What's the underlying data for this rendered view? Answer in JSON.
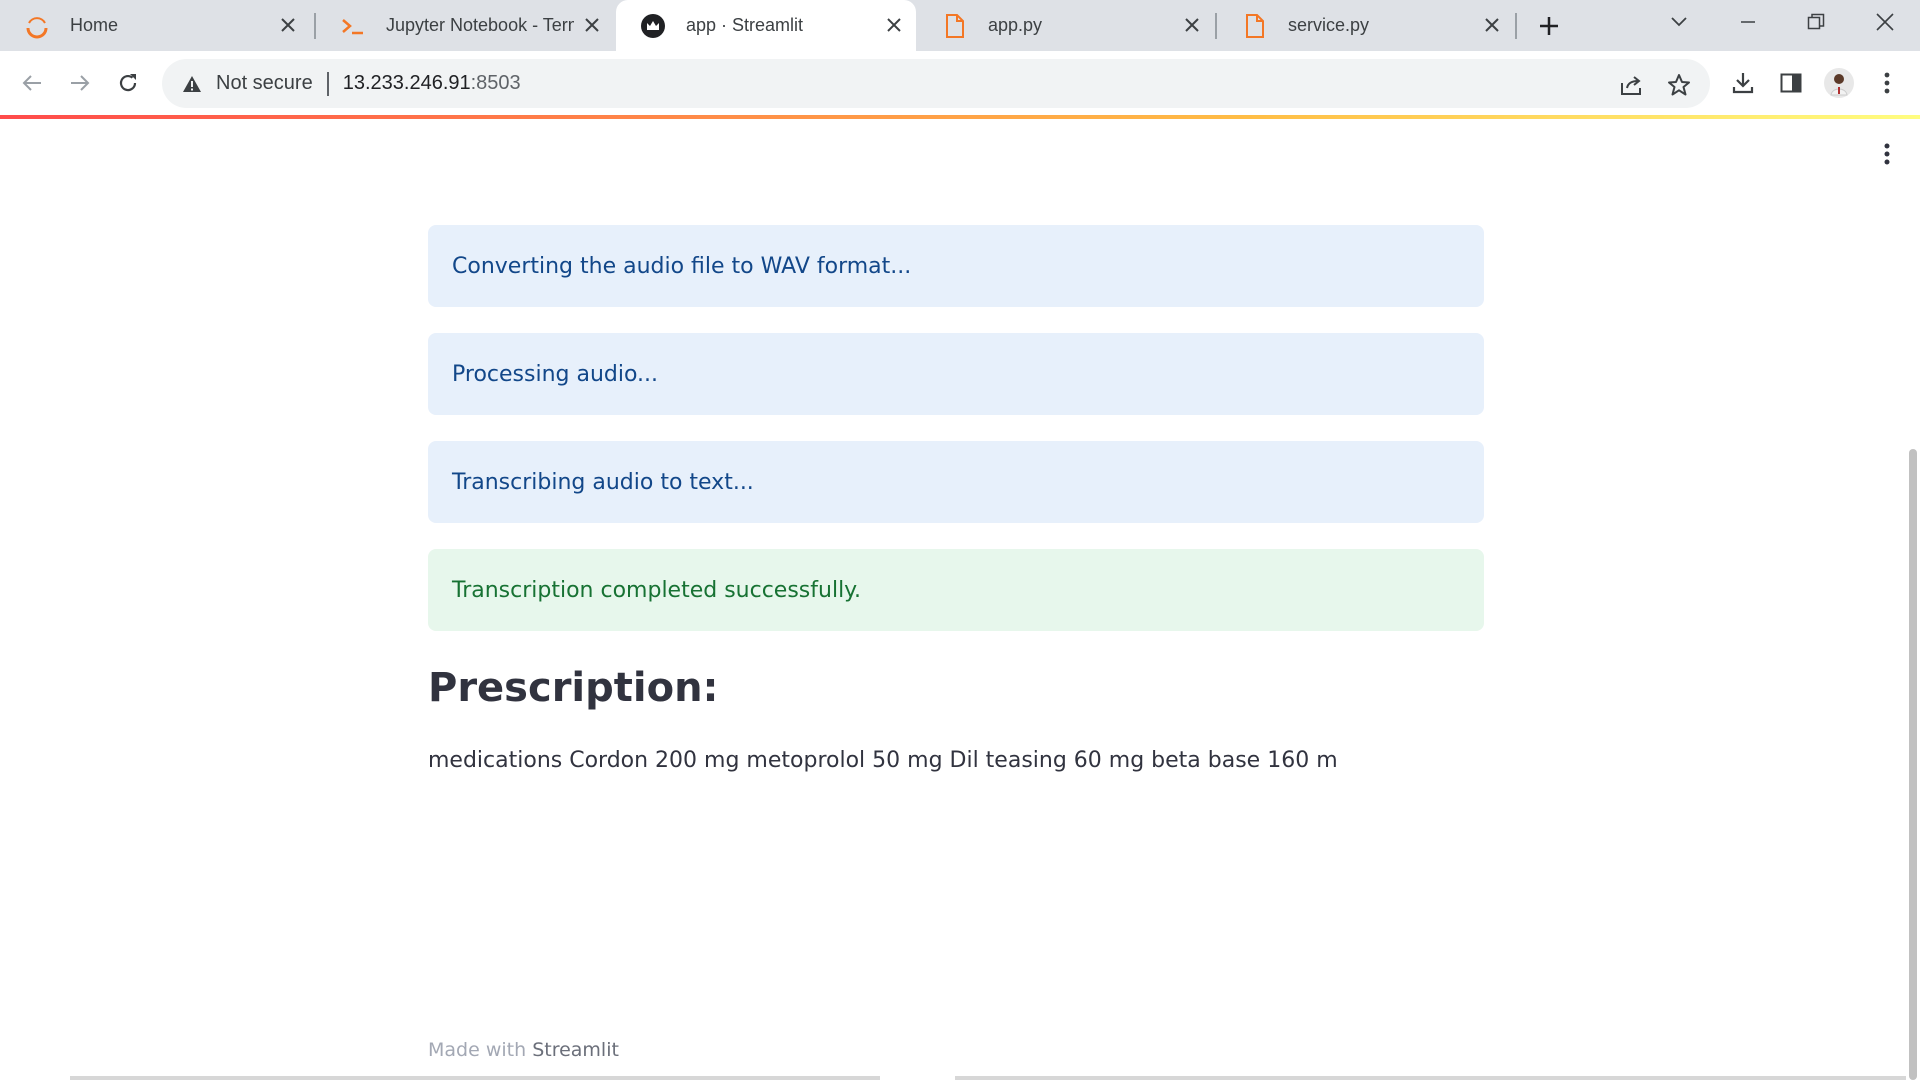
{
  "browser": {
    "tabs": [
      {
        "label": "Home",
        "icon": "jupyter-spinner-icon",
        "active": false
      },
      {
        "label": "Jupyter Notebook - Term",
        "icon": "terminal-icon",
        "active": false
      },
      {
        "label": "app · Streamlit",
        "icon": "streamlit-crown-icon",
        "active": true
      },
      {
        "label": "app.py",
        "icon": "file-icon",
        "active": false
      },
      {
        "label": "service.py",
        "icon": "file-icon",
        "active": false
      }
    ],
    "address": {
      "security_label": "Not secure",
      "host": "13.233.246.91",
      "port": ":8503"
    },
    "colors": {
      "tab_strip": "#dee1e6",
      "accent_orange": "#f37726"
    }
  },
  "app": {
    "status_messages": [
      {
        "kind": "info",
        "text": "Converting the audio file to WAV format..."
      },
      {
        "kind": "info",
        "text": "Processing audio..."
      },
      {
        "kind": "info",
        "text": "Transcribing audio to text..."
      },
      {
        "kind": "success",
        "text": "Transcription completed successfully."
      }
    ],
    "heading": "Prescription:",
    "transcript": "medications Cordon 200 mg metoprolol 50 mg Dil teasing 60 mg beta base 160 m",
    "footer": {
      "prefix": "Made with ",
      "brand": "Streamlit"
    },
    "colors": {
      "info_bg": "#e7f0fb",
      "info_text": "#124789",
      "success_bg": "#e7f7ec",
      "success_text": "#177233"
    }
  }
}
